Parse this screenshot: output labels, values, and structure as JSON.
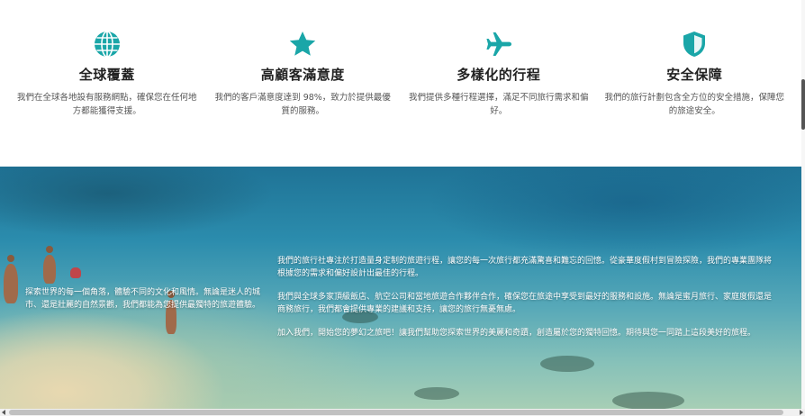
{
  "accent_color": "#1aa6a8",
  "features": [
    {
      "icon": "globe-icon",
      "title": "全球覆蓋",
      "desc": "我們在全球各地設有服務網點，確保您在任何地方都能獲得支援。"
    },
    {
      "icon": "star-icon",
      "title": "高顧客滿意度",
      "desc": "我們的客戶滿意度達到 98%，致力於提供最優質的服務。"
    },
    {
      "icon": "airplane-icon",
      "title": "多樣化的行程",
      "desc": "我們提供多種行程選擇，滿足不同旅行需求和偏好。"
    },
    {
      "icon": "shield-icon",
      "title": "安全保障",
      "desc": "我們的旅行計劃包含全方位的安全措施，保障您的旅途安全。"
    }
  ],
  "hero": {
    "left_text": "探索世界的每一個角落，體驗不同的文化和風情。無論是迷人的城市、還是壯麗的自然景觀，我們都能為您提供最獨特的旅遊體驗。",
    "paragraphs": [
      "我們的旅行社專注於打造量身定制的旅遊行程，讓您的每一次旅行都充滿驚喜和難忘的回憶。從豪華度假村到冒險探險，我們的專業團隊將根據您的需求和偏好設計出最佳的行程。",
      "我們與全球多家頂級飯店、航空公司和當地旅遊合作夥伴合作，確保您在旅途中享受到最好的服務和設施。無論是蜜月旅行、家庭度假還是商務旅行，我們都會提供專業的建議和支持，讓您的旅行無憂無慮。",
      "加入我們，開始您的夢幻之旅吧！讓我們幫助您探索世界的美麗和奇蹟，創造屬於您的獨特回憶。期待與您一同踏上這段美好的旅程。"
    ]
  }
}
